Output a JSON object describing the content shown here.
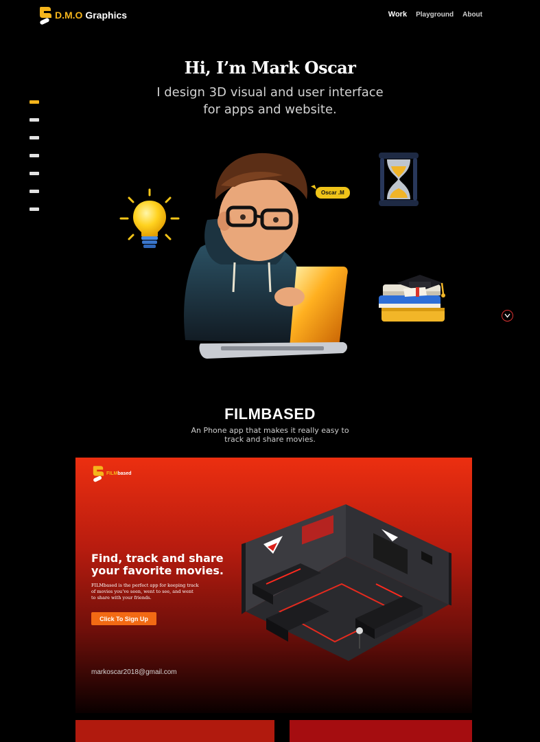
{
  "brand": {
    "name_accent": "D.M.O",
    "name_rest": " Graphics",
    "accent_color": "#f5b51c"
  },
  "nav": {
    "links": [
      {
        "label": "Work",
        "active": true
      },
      {
        "label": "Playground",
        "active": false
      },
      {
        "label": "About",
        "active": false
      }
    ]
  },
  "hero": {
    "title": "Hi, I’m Mark Oscar",
    "subtitle_line1": "I design 3D visual and user interface",
    "subtitle_line2": "for apps and website.",
    "character_tag": "Oscar .M"
  },
  "side_nav": {
    "count": 7,
    "active_index": 0
  },
  "scroll_icon": "chevron-down-icon",
  "project": {
    "title": "FILMBASED",
    "desc_line1": "An Phone app that makes it really easy to",
    "desc_line2": "track and share movies.",
    "card": {
      "logo_accent": "FILM",
      "logo_rest": "based",
      "heading_line1": "Find, track and share",
      "heading_line2": "your favorite movies.",
      "body_line1": "FILMbased is the perfect app for keeping track",
      "body_line2": "of movies you’ve seen, went to see, and went",
      "body_line3": "to share with your friends.",
      "cta_label": "Click To Sign Up",
      "email": "markoscar2018@gmail.com",
      "cta_color": "#f26a14"
    }
  }
}
